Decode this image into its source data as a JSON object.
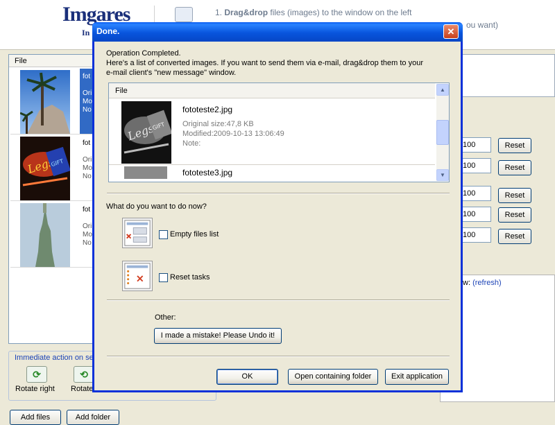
{
  "app": {
    "logo": "Imgares",
    "logo_sub": "In",
    "step1_num": "1.",
    "step1_bold": "Drag&drop",
    "step1_rest": "files (images)  to the window on the left",
    "step2_tail": "ou want)",
    "file_header": "File",
    "rows": [
      {
        "name": "fot",
        "lines": [
          "Ori",
          "Mo",
          "No"
        ],
        "selected": true
      },
      {
        "name": "fot",
        "lines": [
          "Ori",
          "Mo",
          "No"
        ],
        "selected": false
      },
      {
        "name": "fot",
        "lines": [
          "Ori",
          "Mo",
          "No"
        ],
        "selected": false
      }
    ],
    "values": [
      "100",
      "100",
      "100",
      "100",
      "100"
    ],
    "reset_label": "Reset",
    "preview_label": "w:",
    "refresh_label": "(refresh)",
    "immediate_title": "Immediate action on se",
    "rotate_right": "Rotate right",
    "rotate_left": "Rotate",
    "add_files": "Add files",
    "add_folder": "Add folder"
  },
  "dialog": {
    "title": "Done.",
    "close_glyph": "✕",
    "intro_line1": "Operation Completed.",
    "intro_line2": "Here's a list of converted images. If you want to send them via e-mail, drag&drop them to your",
    "intro_line3": "e-mail client's \"new message\" window.",
    "list_header": "File",
    "items": [
      {
        "name": "fototeste2.jpg",
        "size": "Original size:47,8 KB",
        "modified": "Modified:2009-10-13 13:06:49",
        "note": "Note:"
      },
      {
        "name": "fototeste3.jpg"
      }
    ],
    "question": "What do you want to do now?",
    "empty_files_label": "Empty files list",
    "reset_tasks_label": "Reset tasks",
    "other_label": "Other:",
    "undo_label": "I made a mistake! Please Undo it!",
    "ok_label": "OK",
    "open_folder_label": "Open containing folder",
    "exit_label": "Exit application"
  }
}
